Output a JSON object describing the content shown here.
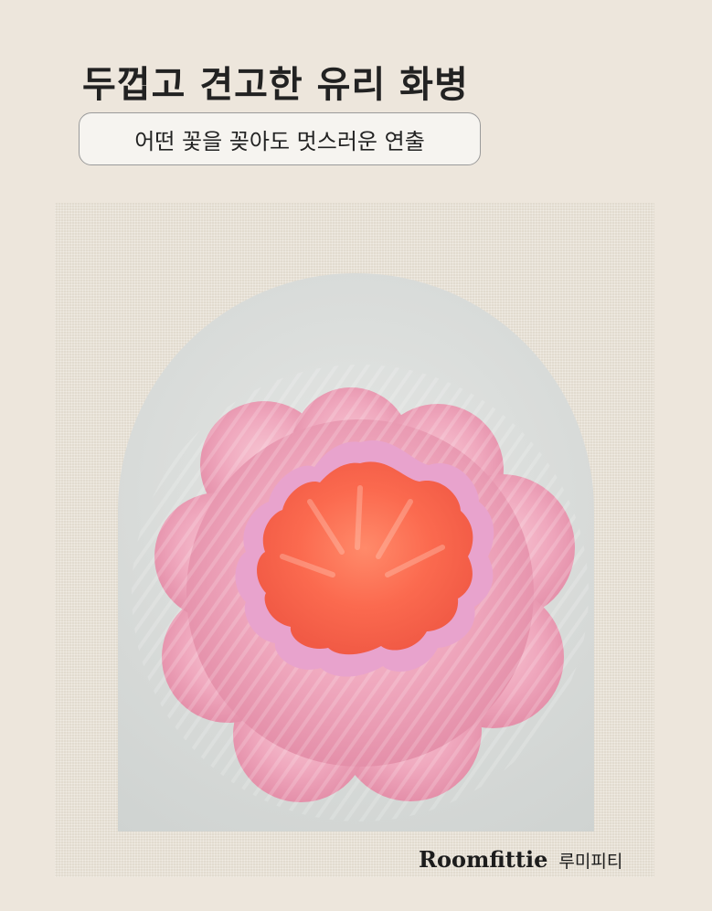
{
  "headline": "두껍고 견고한 유리 화병",
  "subtitle": "어떤 꽃을 꽂아도 멋스러운 연출",
  "brand": {
    "name": "Roomfittie",
    "korean": "루미피티"
  },
  "colors": {
    "background": "#ede6dc",
    "vase_pink": "#f0a9c0",
    "vase_rim": "#e79fc7",
    "vase_interior": "#f9674d"
  }
}
